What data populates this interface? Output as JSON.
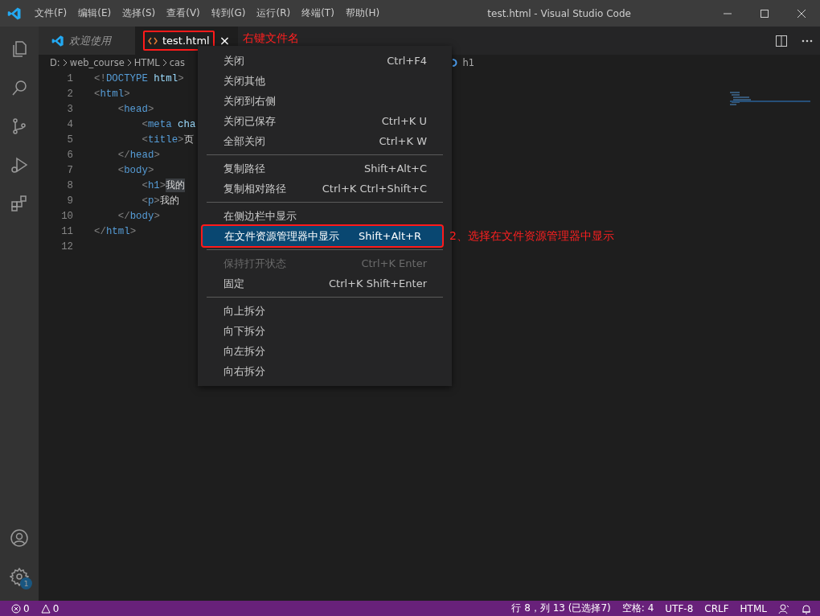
{
  "window": {
    "title": "test.html - Visual Studio Code"
  },
  "menubar": [
    "文件(F)",
    "编辑(E)",
    "选择(S)",
    "查看(V)",
    "转到(G)",
    "运行(R)",
    "终端(T)",
    "帮助(H)"
  ],
  "activity_bar": {
    "top": [
      {
        "kind": "files",
        "selected": false
      },
      {
        "kind": "search",
        "selected": false
      },
      {
        "kind": "scm",
        "selected": false
      },
      {
        "kind": "debug",
        "selected": false
      },
      {
        "kind": "extensions",
        "selected": false
      }
    ],
    "bottom": [
      {
        "kind": "account"
      },
      {
        "kind": "settings",
        "badge": "1"
      }
    ]
  },
  "tabs": [
    {
      "label": "欢迎使用",
      "kind": "welcome",
      "selected": false,
      "preview": true,
      "highlighted": false
    },
    {
      "label": "test.html",
      "kind": "html",
      "selected": true,
      "preview": false,
      "highlighted": true,
      "close": "×",
      "annotation": "右键文件名"
    }
  ],
  "breadcrumb": [
    "D:",
    "web_course",
    "HTML",
    "cas"
  ],
  "breadcrumb_tail": "h1",
  "code": [
    {
      "number": "1",
      "tokens": [
        {
          "kind": "punct",
          "text": "<!"
        },
        {
          "kind": "tag",
          "text": "DOCTYPE"
        },
        {
          "kind": "attr",
          "text": " html"
        },
        {
          "kind": "punct",
          "text": ">"
        }
      ]
    },
    {
      "number": "2",
      "tokens": [
        {
          "kind": "punct",
          "text": "<"
        },
        {
          "kind": "tag",
          "text": "html"
        },
        {
          "kind": "punct",
          "text": ">"
        }
      ]
    },
    {
      "number": "3",
      "tokens": [
        {
          "kind": "punct",
          "text": "    <"
        },
        {
          "kind": "tag",
          "text": "head"
        },
        {
          "kind": "punct",
          "text": ">"
        }
      ]
    },
    {
      "number": "4",
      "tokens": [
        {
          "kind": "punct",
          "text": "        <"
        },
        {
          "kind": "tag",
          "text": "meta"
        },
        {
          "kind": "attr",
          "text": " cha"
        }
      ]
    },
    {
      "number": "5",
      "tokens": [
        {
          "kind": "punct",
          "text": "        <"
        },
        {
          "kind": "tag",
          "text": "title"
        },
        {
          "kind": "punct",
          "text": ">"
        },
        {
          "kind": "text",
          "text": "页"
        }
      ]
    },
    {
      "number": "6",
      "tokens": [
        {
          "kind": "punct",
          "text": "    </"
        },
        {
          "kind": "tag",
          "text": "head"
        },
        {
          "kind": "punct",
          "text": ">"
        }
      ]
    },
    {
      "number": "7",
      "tokens": [
        {
          "kind": "punct",
          "text": "    <"
        },
        {
          "kind": "tag",
          "text": "body"
        },
        {
          "kind": "punct",
          "text": ">"
        }
      ]
    },
    {
      "number": "8",
      "tokens": [
        {
          "kind": "punct",
          "text": "        <"
        },
        {
          "kind": "tag",
          "text": "h1"
        },
        {
          "kind": "punct",
          "text": ">"
        },
        {
          "kind": "selection",
          "text": "我的"
        }
      ]
    },
    {
      "number": "9",
      "tokens": [
        {
          "kind": "punct",
          "text": "        <"
        },
        {
          "kind": "tag",
          "text": "p"
        },
        {
          "kind": "punct",
          "text": ">"
        },
        {
          "kind": "text",
          "text": "我的"
        }
      ]
    },
    {
      "number": "10",
      "tokens": [
        {
          "kind": "punct",
          "text": "    </"
        },
        {
          "kind": "tag",
          "text": "body"
        },
        {
          "kind": "punct",
          "text": ">"
        }
      ]
    },
    {
      "number": "11",
      "tokens": [
        {
          "kind": "punct",
          "text": "</"
        },
        {
          "kind": "tag",
          "text": "html"
        },
        {
          "kind": "punct",
          "text": ">"
        }
      ]
    },
    {
      "number": "12"
    }
  ],
  "context_menu": {
    "groups": [
      [
        {
          "label": "关闭",
          "shortcut": "Ctrl+F4",
          "disabled": false,
          "selected": false
        },
        {
          "label": "关闭其他",
          "disabled": false,
          "selected": false
        },
        {
          "label": "关闭到右侧",
          "disabled": false,
          "selected": false
        },
        {
          "label": "关闭已保存",
          "shortcut": "Ctrl+K U",
          "disabled": false,
          "selected": false
        },
        {
          "label": "全部关闭",
          "shortcut": "Ctrl+K W",
          "disabled": false,
          "selected": false
        }
      ],
      [
        {
          "label": "复制路径",
          "shortcut": "Shift+Alt+C",
          "disabled": false,
          "selected": false
        },
        {
          "label": "复制相对路径",
          "shortcut": "Ctrl+K Ctrl+Shift+C",
          "disabled": false,
          "selected": false
        }
      ],
      [
        {
          "label": "在侧边栏中显示",
          "disabled": false,
          "selected": false
        },
        {
          "label": "在文件资源管理器中显示",
          "shortcut": "Shift+Alt+R",
          "disabled": false,
          "selected": true,
          "highlighted": true,
          "annotation": "2、选择在文件资源管理器中显示"
        }
      ],
      [
        {
          "label": "保持打开状态",
          "shortcut": "Ctrl+K Enter",
          "disabled": true,
          "selected": false
        },
        {
          "label": "固定",
          "shortcut": "Ctrl+K Shift+Enter",
          "disabled": false,
          "selected": false
        }
      ],
      [
        {
          "label": "向上拆分",
          "disabled": false,
          "selected": false
        },
        {
          "label": "向下拆分",
          "disabled": false,
          "selected": false
        },
        {
          "label": "向左拆分",
          "disabled": false,
          "selected": false
        },
        {
          "label": "向右拆分",
          "disabled": false,
          "selected": false
        }
      ]
    ]
  },
  "status_bar": {
    "errors": "0",
    "warnings": "0",
    "items": [
      "行 8，列 13 (已选择7)",
      "空格: 4",
      "UTF-8",
      "CRLF",
      "HTML"
    ]
  }
}
